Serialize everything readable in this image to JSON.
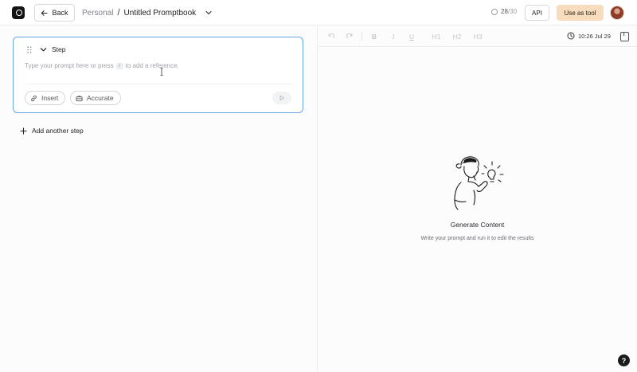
{
  "header": {
    "back_label": "Back",
    "breadcrumb_parent": "Personal",
    "breadcrumb_separator": "/",
    "document_title": "Untitled Promptbook",
    "credits_used": "28",
    "credits_total": "/30",
    "api_label": "API",
    "use_as_tool_label": "Use as tool"
  },
  "step": {
    "label": "Step",
    "prompt_placeholder_before": "Type your prompt here or press",
    "prompt_shortcut_key": "/",
    "prompt_placeholder_after": "to add a reference.",
    "insert_label": "Insert",
    "accurate_label": "Accurate"
  },
  "add_step_label": "Add another step",
  "editor": {
    "heading_buttons": [
      "H1",
      "H2",
      "H3"
    ],
    "timestamp": "10:26 Jul 29",
    "empty_title": "Generate Content",
    "empty_subtitle": "Write your prompt and run it to edit the results"
  },
  "help_label": "?",
  "colors": {
    "accent_border": "#64a6e6",
    "use_as_tool_bg": "#f7ddbe"
  }
}
